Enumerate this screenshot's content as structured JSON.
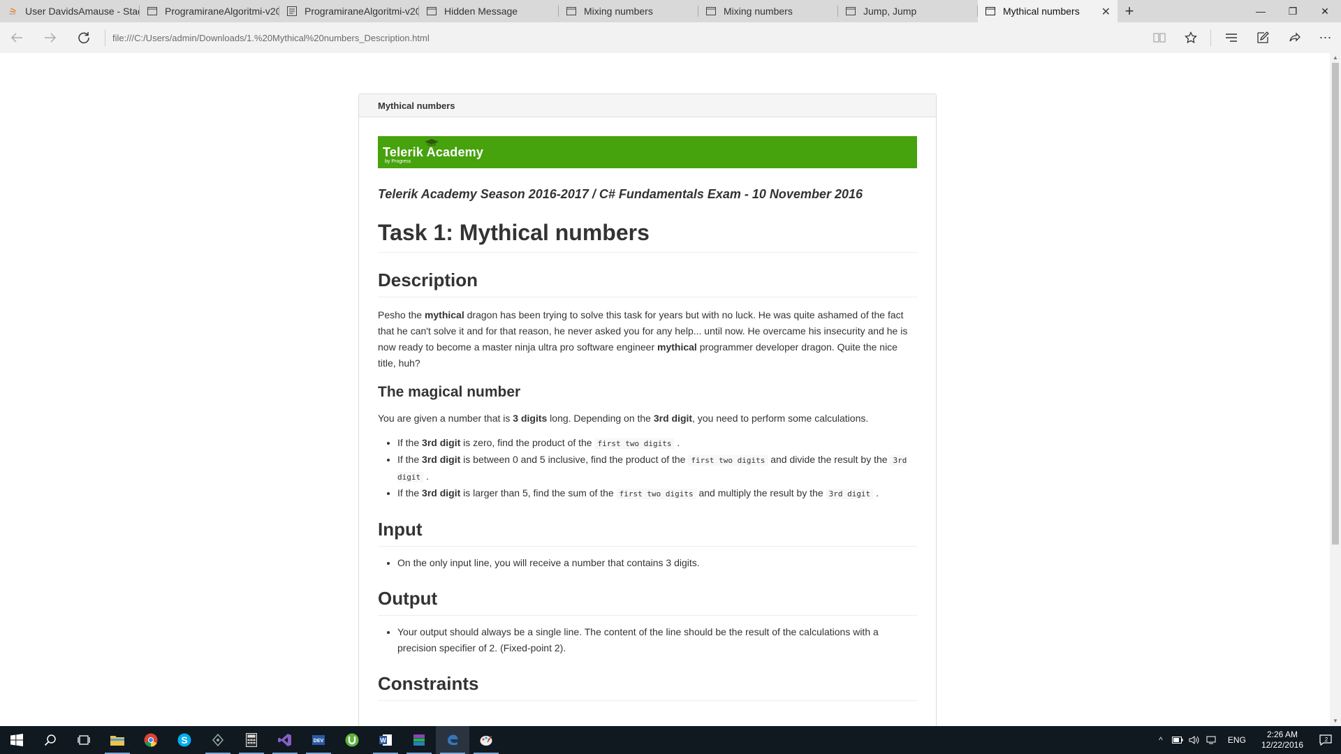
{
  "browser": {
    "tabs": [
      {
        "title": "User DavidsAmause - Stack",
        "icon": "stack-overflow-icon"
      },
      {
        "title": "ProgramiraneAlgoritmi-v20",
        "icon": "page-icon"
      },
      {
        "title": "ProgramiraneAlgoritmi-v20",
        "icon": "document-icon"
      },
      {
        "title": "Hidden Message",
        "icon": "page-icon"
      },
      {
        "title": "Mixing numbers",
        "icon": "page-icon"
      },
      {
        "title": "Mixing numbers",
        "icon": "page-icon"
      },
      {
        "title": "Jump, Jump",
        "icon": "page-icon"
      },
      {
        "title": "Mythical numbers",
        "icon": "page-icon",
        "active": true
      }
    ],
    "address": "file:///C:/Users/admin/Downloads/1.%20Mythical%20numbers_Description.html"
  },
  "page": {
    "panel_title": "Mythical numbers",
    "logo_text": "Telerik Academy",
    "logo_sub": "by Progress",
    "logo_color": "#46a20d",
    "season": "Telerik Academy Season 2016-2017 / C# Fundamentals Exam - 10 November 2016",
    "task_title": "Task 1: Mythical numbers",
    "description": {
      "heading": "Description",
      "p1": "Pesho the ",
      "b1": "mythical",
      "p2": " dragon has been trying to solve this task for years but with no luck. He was quite ashamed of the fact that he can't solve it and for that reason, he never asked you for any help... until now. He overcame his insecurity and he is now ready to become a master ninja ultra pro software engineer ",
      "b2": "mythical",
      "p3": " programmer developer dragon. Quite the nice title, huh?"
    },
    "magical": {
      "heading": "The magical number",
      "t1": "You are given a number that is ",
      "b1": "3 digits",
      "t2": " long. Depending on the ",
      "b2": "3rd digit",
      "t3": ", you need to perform some calculations.",
      "li1_a": "If the ",
      "li1_b": "3rd digit",
      "li1_c": " is zero, find the product of the ",
      "li1_code": "first two digits",
      "li1_d": " .",
      "li2_a": "If the ",
      "li2_b": "3rd digit",
      "li2_c": " is between 0 and 5 inclusive, find the product of the ",
      "li2_code": "first two digits",
      "li2_d": " and divide the result by the ",
      "li2_code2": "3rd digit",
      "li2_e": " .",
      "li3_a": "If the ",
      "li3_b": "3rd digit",
      "li3_c": " is larger than 5, find the sum of the ",
      "li3_code": "first two digits",
      "li3_d": " and multiply the result by the ",
      "li3_code2": "3rd digit",
      "li3_e": " ."
    },
    "input": {
      "heading": "Input",
      "li1": "On the only input line, you will receive a number that contains 3 digits."
    },
    "output": {
      "heading": "Output",
      "li1": "Your output should always be a single line. The content of the line should be the result of the calculations with a precision specifier of 2. (Fixed-point 2)."
    },
    "constraints": {
      "heading": "Constraints"
    }
  },
  "taskbar": {
    "apps": [
      "start-icon",
      "search-icon",
      "task-view-icon",
      "file-explorer-icon",
      "chrome-icon",
      "skype-icon",
      "app-icon",
      "calculator-icon",
      "visual-studio-icon",
      "devexpress-icon",
      "utorrent-icon",
      "word-icon",
      "winrar-icon",
      "edge-icon",
      "paint-icon"
    ],
    "lang": "ENG",
    "time": "2:26 AM",
    "date": "12/22/2016",
    "notifications": "2"
  }
}
